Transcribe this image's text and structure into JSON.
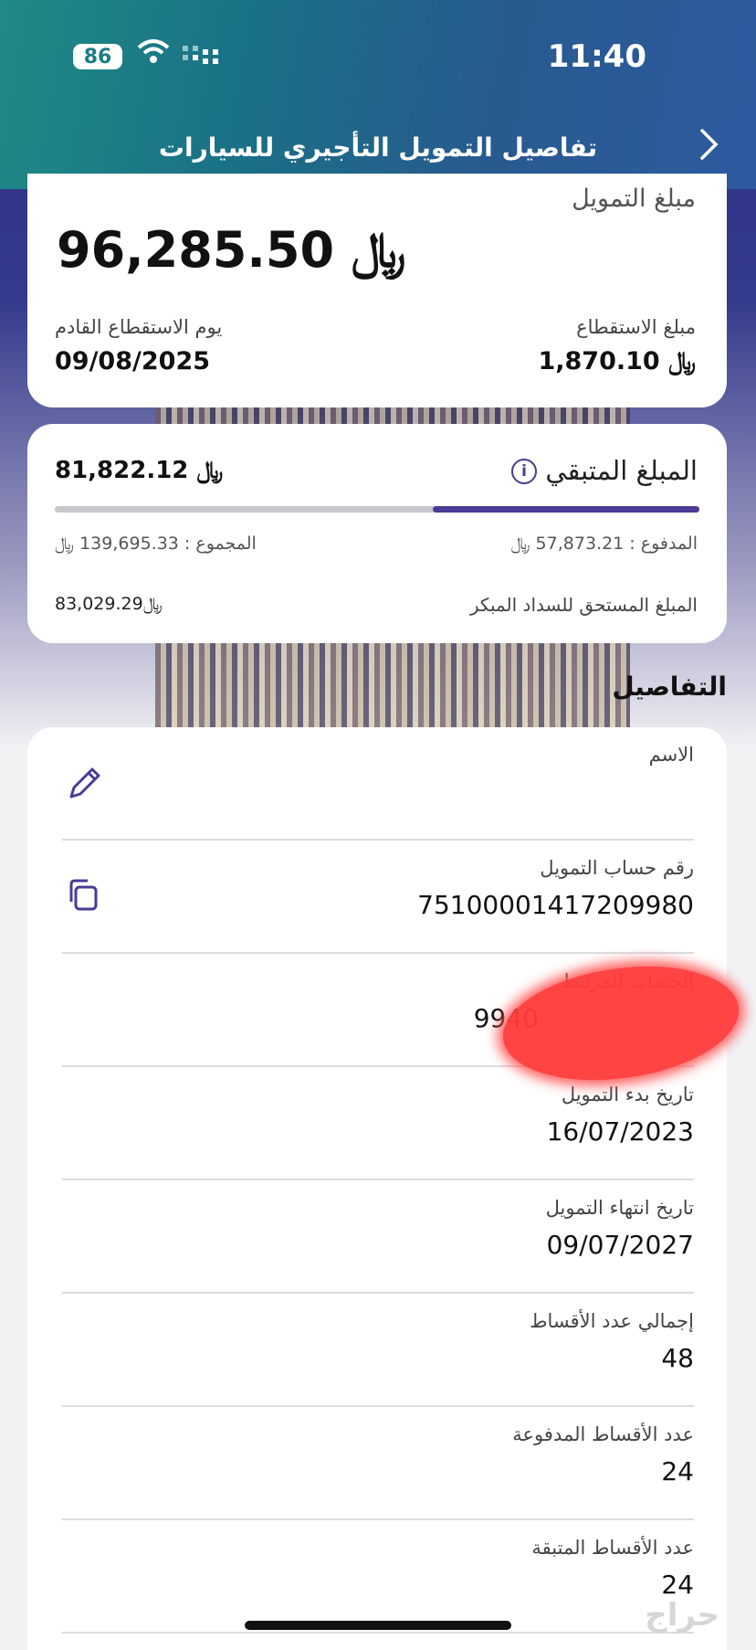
{
  "status_bar": {
    "battery": "86",
    "time": "11:40"
  },
  "header": {
    "title": "تفاصيل التمويل التأجيري للسيارات"
  },
  "currency": "﷼",
  "financing": {
    "amount_label": "مبلغ التمويل",
    "amount": "96,285.50",
    "deduction_label": "مبلغ الاستقطاع",
    "deduction_amount": "1,870.10",
    "next_deduction_label": "يوم الاستقطاع القادم",
    "next_deduction_date": "09/08/2025"
  },
  "remaining": {
    "label": "المبلغ المتبقي",
    "amount": "81,822.12",
    "paid_fraction": 0.414,
    "paid_text": "المدفوع : 57,873.21",
    "total_text": "المجموع : 139,695.33",
    "early_label": "المبلغ المستحق للسداد المبكر",
    "early_amount": "83,029.29"
  },
  "details": {
    "title": "التفاصيل",
    "rows": [
      {
        "label": "الاسم",
        "value": ""
      },
      {
        "label": "رقم حساب التمويل",
        "value": "7510000141720998​0"
      },
      {
        "label": "الحساب المرتبط",
        "value": "9940"
      },
      {
        "label": "تاريخ بدء التمويل",
        "value": "16/07/2023"
      },
      {
        "label": "تاريخ انتهاء التمويل",
        "value": "09/07/2027"
      },
      {
        "label": "إجمالي عدد الأقساط",
        "value": "48"
      },
      {
        "label": "عدد الأقساط المدفوعة",
        "value": "24"
      },
      {
        "label": "عدد الأقساط المتبقة",
        "value": "24"
      }
    ]
  },
  "watermark": "حراج"
}
